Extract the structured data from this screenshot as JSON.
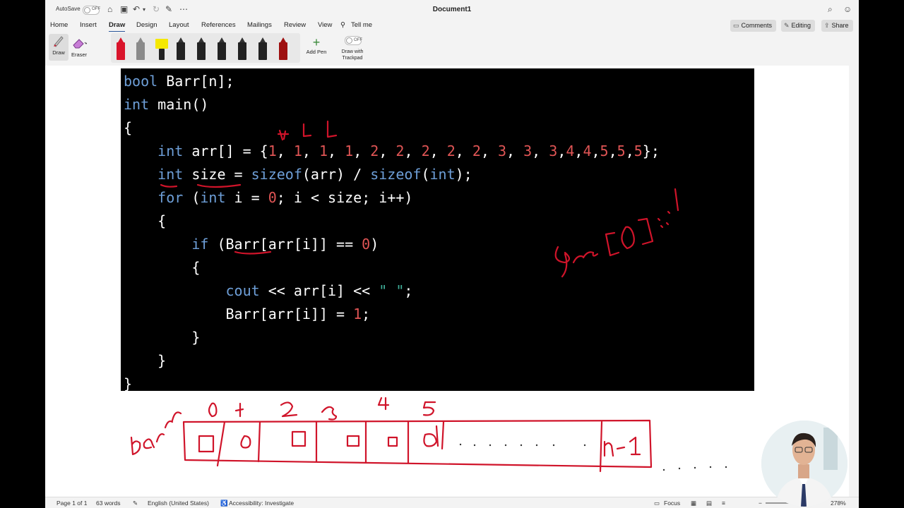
{
  "title_bar": {
    "autosave_label": "AutoSave",
    "autosave_state": "OFF",
    "document_title": "Document1"
  },
  "ribbon": {
    "tabs": [
      {
        "label": "Home"
      },
      {
        "label": "Insert"
      },
      {
        "label": "Draw",
        "active": true
      },
      {
        "label": "Design"
      },
      {
        "label": "Layout"
      },
      {
        "label": "References"
      },
      {
        "label": "Mailings"
      },
      {
        "label": "Review"
      },
      {
        "label": "View"
      },
      {
        "label": "Tell me"
      }
    ],
    "comments_label": "Comments",
    "editing_label": "Editing",
    "share_label": "Share"
  },
  "draw_toolbar": {
    "draw_label": "Draw",
    "eraser_label": "Eraser",
    "add_pen_label": "Add Pen",
    "trackpad_toggle_state": "OFF",
    "trackpad_label_line1": "Draw with",
    "trackpad_label_line2": "Trackpad",
    "pen_colors": [
      "#d9142b",
      "#8a8a8a",
      "#f5e800",
      "#222222",
      "#222222",
      "#222222",
      "#222222",
      "#222222",
      "#222222",
      "#9e1010"
    ]
  },
  "code_lines": [
    "bool Barr[n];",
    "int main()",
    "{",
    "    int arr[] = {1, 1, 1, 1, 2, 2, 2, 2, 2, 3, 3, 3,4,4,5,5,5};",
    "    int size = sizeof(arr) / sizeof(int);",
    "    for (int i = 0; i < size; i++)",
    "    {",
    "        if (Barr[arr[i]] == 0)",
    "        {",
    "            cout << arr[i] << \" \";",
    "            Barr[arr[i]] = 1;",
    "        }",
    "    }",
    "}"
  ],
  "status_bar": {
    "page": "Page 1 of 1",
    "words": "63 words",
    "language": "English (United States)",
    "accessibility": "Accessibility: Investigate",
    "focus": "Focus",
    "zoom": "278%"
  },
  "colors": {
    "ink": "#d0142a",
    "keyword": "#6e9fd8",
    "number": "#e05555",
    "string": "#3fb09a",
    "code_background": "#000000"
  }
}
